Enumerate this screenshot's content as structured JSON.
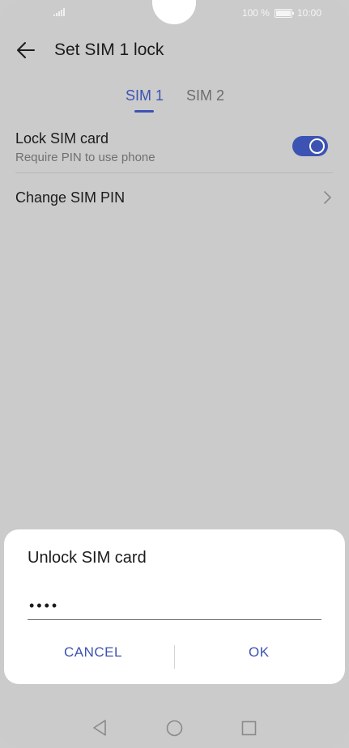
{
  "status_bar": {
    "battery": "100 %",
    "time": "10:00"
  },
  "header": {
    "title": "Set SIM 1 lock",
    "back_icon": "arrow-left-icon"
  },
  "tabs": [
    {
      "label": "SIM 1",
      "active": true
    },
    {
      "label": "SIM 2",
      "active": false
    }
  ],
  "settings": {
    "lock_sim": {
      "label": "Lock SIM card",
      "description": "Require PIN to use phone",
      "enabled": true
    },
    "change_pin": {
      "label": "Change SIM PIN",
      "icon": "chevron-right-icon"
    }
  },
  "dialog": {
    "title": "Unlock SIM card",
    "pin_value": "••••",
    "cancel_label": "CANCEL",
    "ok_label": "OK"
  },
  "nav": {
    "back_icon": "triangle-back-icon",
    "home_icon": "circle-home-icon",
    "recent_icon": "square-recent-icon"
  },
  "colors": {
    "accent": "#3d53b3",
    "scrim_bg": "#cbcbcb",
    "dialog_bg": "#ffffff"
  }
}
